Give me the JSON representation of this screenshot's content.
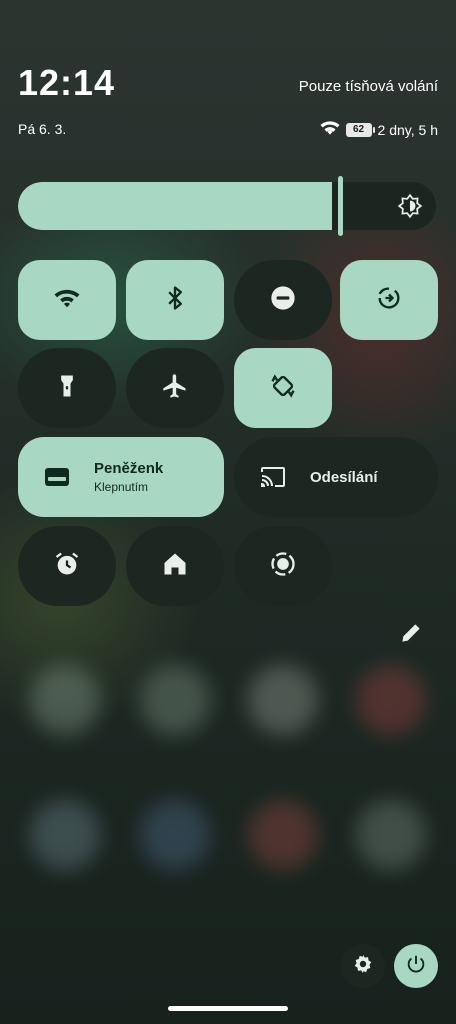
{
  "status": {
    "time": "12:14",
    "date": "Pá 6. 3.",
    "carrier": "Pouze tísňová volání",
    "battery_percent": "62",
    "battery_estimate": "2 dny, 5 h"
  },
  "brightness": {
    "level": 0.75,
    "icon": "brightness-auto-icon"
  },
  "tiles": [
    {
      "id": "wifi",
      "icon": "wifi-icon",
      "active": true
    },
    {
      "id": "bluetooth",
      "icon": "bluetooth-icon",
      "active": true
    },
    {
      "id": "do-not-disturb",
      "icon": "do-not-disturb-icon",
      "active": false
    },
    {
      "id": "data-saver",
      "icon": "data-saver-icon",
      "active": true
    },
    {
      "id": "flashlight",
      "icon": "flashlight-icon",
      "active": false
    },
    {
      "id": "airplane-mode",
      "icon": "airplane-icon",
      "active": false
    },
    {
      "id": "auto-rotate",
      "icon": "rotate-icon",
      "active": true
    },
    {
      "id": "alarm",
      "icon": "alarm-icon",
      "active": false
    },
    {
      "id": "home",
      "icon": "home-icon",
      "active": false
    },
    {
      "id": "screen-record",
      "icon": "screen-record-icon",
      "active": false
    }
  ],
  "wallet": {
    "title": "Peněženk",
    "subtitle": "Klepnutím",
    "icon": "wallet-icon",
    "active": true
  },
  "cast": {
    "title": "Odesílání",
    "icon": "cast-icon",
    "active": false
  },
  "footer": {
    "edit_icon": "pencil-icon",
    "settings_icon": "gear-icon",
    "power_icon": "power-icon"
  },
  "colors": {
    "accent": "#a8d8c3",
    "tile_off": "#1c2722",
    "icon_on": "#0f2a20"
  }
}
